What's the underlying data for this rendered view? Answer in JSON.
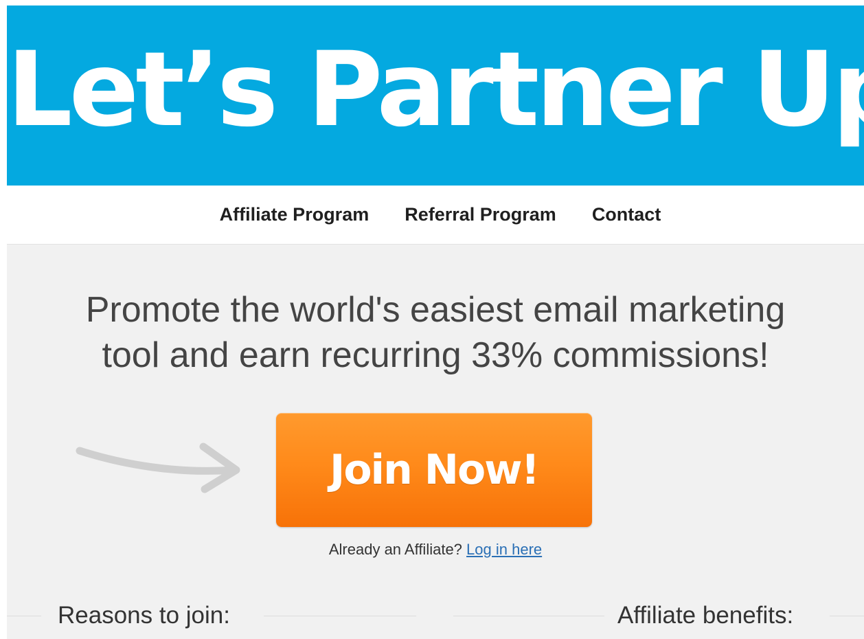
{
  "hero": {
    "title": "Let’s Partner Up!",
    "background_color": "#04a9e0"
  },
  "nav": {
    "items": [
      {
        "label": "Affiliate Program"
      },
      {
        "label": "Referral Program"
      },
      {
        "label": "Contact"
      }
    ]
  },
  "main": {
    "headline_line1": "Promote the world's easiest email marketing",
    "headline_line2": "tool and earn recurring 33% commissions!",
    "cta_label": "Join Now!",
    "cta_color": "#ff8a1a",
    "arrow_icon": "arrow-right-icon",
    "affiliate_prompt": "Already an Affiliate?",
    "login_link": "Log in here",
    "link_color": "#2a6fb5"
  },
  "sections": {
    "reasons_heading": "Reasons to join:",
    "benefits_heading": "Affiliate benefits:"
  }
}
